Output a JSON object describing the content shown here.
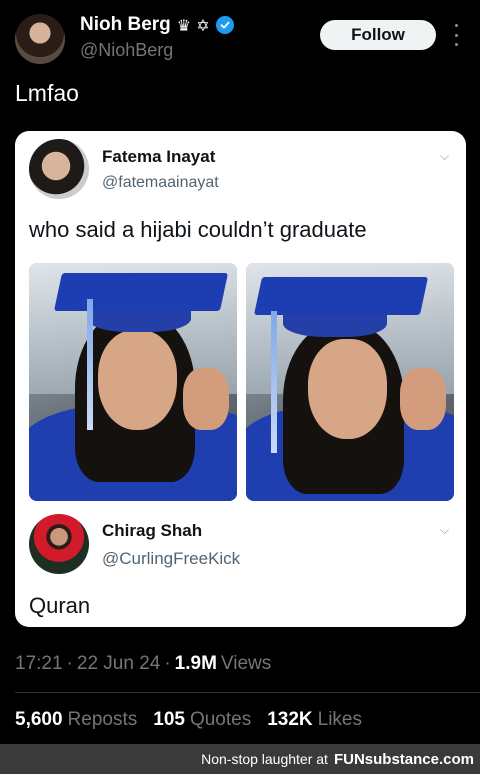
{
  "header": {
    "display_name": "Nioh Berg",
    "badges": "♛ ✡",
    "handle": "@NiohBerg",
    "follow_label": "Follow",
    "accent_color": "#1d9bf0"
  },
  "tweet": {
    "text": "Lmfao"
  },
  "quoted_card": {
    "author_name": "Fatema Inayat",
    "author_handle": "@fatemaainayat",
    "text": "who said a hijabi couldn’t graduate",
    "reply": {
      "author_name": "Chirag Shah",
      "author_handle": "@CurlingFreeKick",
      "text": "Quran"
    }
  },
  "meta": {
    "time": "17:21",
    "sep1": "·",
    "date": "22 Jun 24",
    "sep2": "·",
    "views_count": "1.9M",
    "views_label": "Views"
  },
  "stats": [
    {
      "count": "5,600",
      "label": "Reposts"
    },
    {
      "count": "105",
      "label": "Quotes"
    },
    {
      "count": "132K",
      "label": "Likes"
    }
  ],
  "watermark": {
    "text": "Non-stop laughter at",
    "brand": "FUNsubstance.com"
  }
}
